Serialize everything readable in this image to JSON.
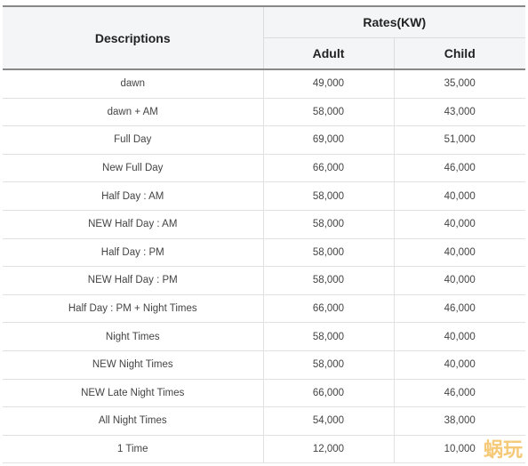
{
  "header": {
    "descriptions": "Descriptions",
    "rates": "Rates(KW)",
    "adult": "Adult",
    "child": "Child"
  },
  "rows": [
    {
      "desc": "dawn",
      "adult": "49,000",
      "child": "35,000"
    },
    {
      "desc": "dawn + AM",
      "adult": "58,000",
      "child": "43,000"
    },
    {
      "desc": "Full Day",
      "adult": "69,000",
      "child": "51,000"
    },
    {
      "desc": "New Full Day",
      "adult": "66,000",
      "child": "46,000"
    },
    {
      "desc": "Half Day : AM",
      "adult": "58,000",
      "child": "40,000"
    },
    {
      "desc": "NEW Half Day : AM",
      "adult": "58,000",
      "child": "40,000"
    },
    {
      "desc": "Half Day : PM",
      "adult": "58,000",
      "child": "40,000"
    },
    {
      "desc": "NEW Half Day : PM",
      "adult": "58,000",
      "child": "40,000"
    },
    {
      "desc": "Half Day : PM + Night Times",
      "adult": "66,000",
      "child": "46,000"
    },
    {
      "desc": "Night Times",
      "adult": "58,000",
      "child": "40,000"
    },
    {
      "desc": "NEW Night Times",
      "adult": "58,000",
      "child": "40,000"
    },
    {
      "desc": "NEW Late Night Times",
      "adult": "66,000",
      "child": "46,000"
    },
    {
      "desc": "All Night Times",
      "adult": "54,000",
      "child": "38,000"
    },
    {
      "desc": "1 Time",
      "adult": "12,000",
      "child": "10,000"
    }
  ],
  "watermark": "蜗玩"
}
